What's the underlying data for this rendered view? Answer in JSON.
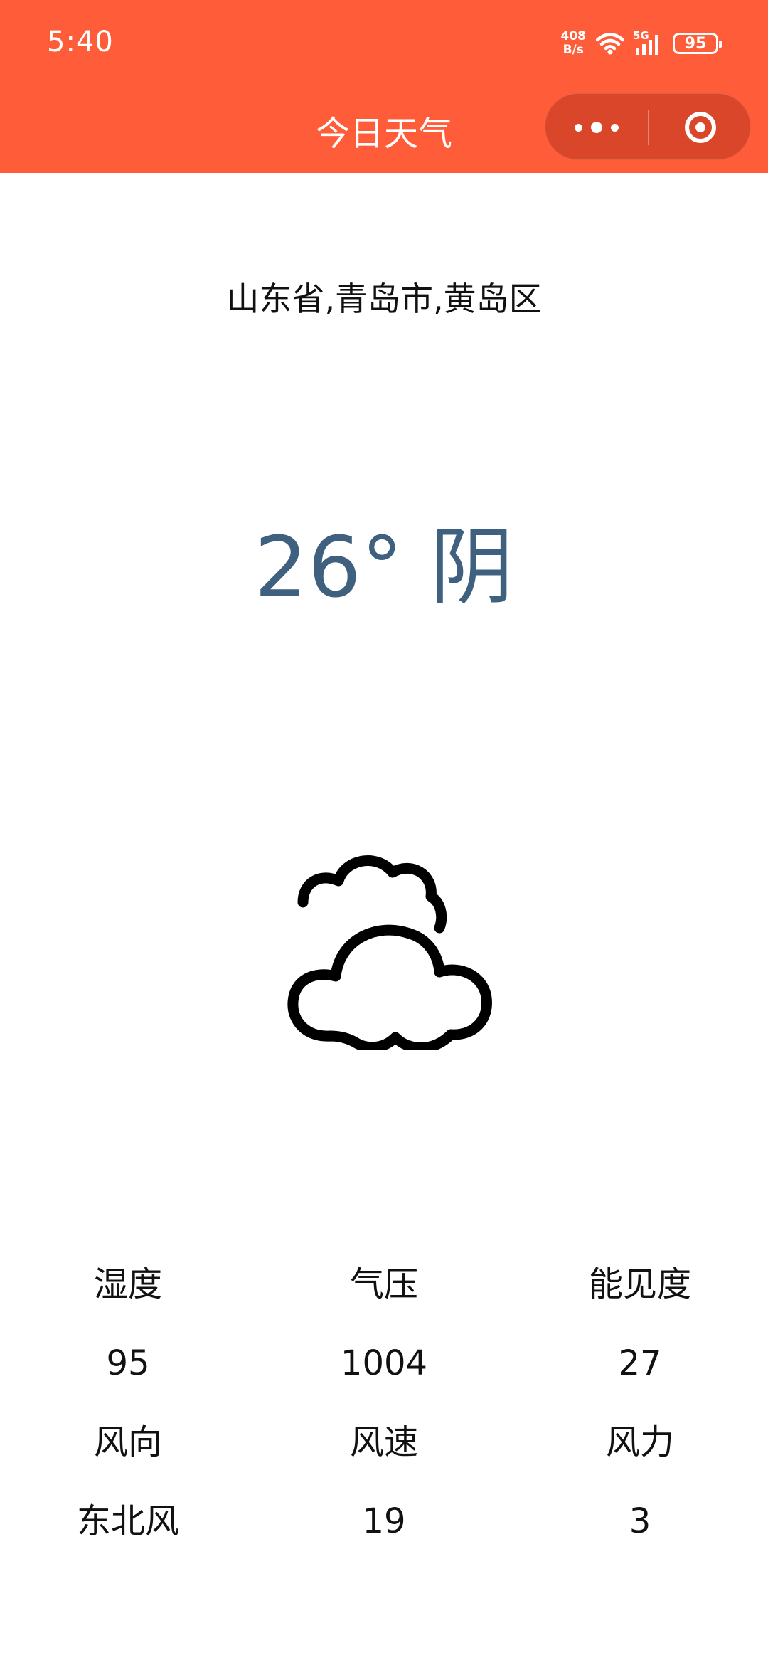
{
  "status_bar": {
    "time": "5:40",
    "net_speed_value": "408",
    "net_speed_unit": "B/s",
    "network_type": "5G",
    "battery": "95"
  },
  "nav": {
    "title": "今日天气"
  },
  "weather": {
    "location": "山东省,青岛市,黄岛区",
    "temperature": "26°",
    "condition": "阴",
    "icon": "cloudy-icon"
  },
  "stats": {
    "row1": {
      "labels": [
        "湿度",
        "气压",
        "能见度"
      ],
      "values": [
        "95",
        "1004",
        "27"
      ]
    },
    "row2": {
      "labels": [
        "风向",
        "风速",
        "风力"
      ],
      "values": [
        "东北风",
        "19",
        "3"
      ]
    }
  },
  "colors": {
    "header": "#ff5c3a",
    "capsule": "#d9462a",
    "temperature_text": "#3f607e"
  }
}
